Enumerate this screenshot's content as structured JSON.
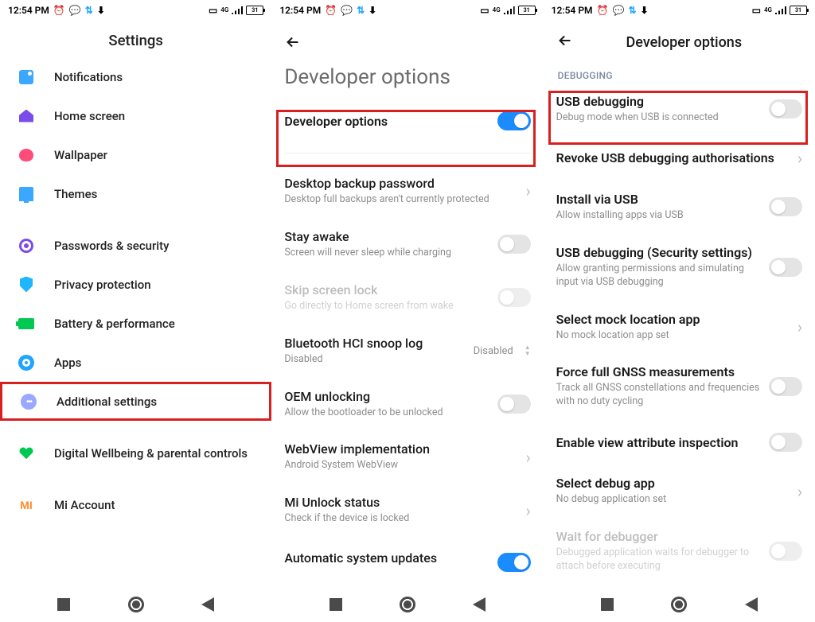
{
  "status": {
    "time": "12:54 PM",
    "battery_text": "31"
  },
  "phone1": {
    "title": "Settings",
    "items": [
      {
        "label": "Notifications"
      },
      {
        "label": "Home screen"
      },
      {
        "label": "Wallpaper"
      },
      {
        "label": "Themes"
      },
      {
        "label": "Passwords & security"
      },
      {
        "label": "Privacy protection"
      },
      {
        "label": "Battery & performance"
      },
      {
        "label": "Apps"
      },
      {
        "label": "Additional settings"
      },
      {
        "label": "Digital Wellbeing & parental controls"
      },
      {
        "label": "Mi Account"
      }
    ]
  },
  "phone2": {
    "heading": "Developer options",
    "master": {
      "title": "Developer options",
      "on": true
    },
    "rows": [
      {
        "title": "Desktop backup password",
        "sub": "Desktop full backups aren't currently protected",
        "type": "chevron"
      },
      {
        "title": "Stay awake",
        "sub": "Screen will never sleep while charging",
        "type": "toggle",
        "on": false
      },
      {
        "title": "Skip screen lock",
        "sub": "Go directly to Home screen from wake",
        "type": "toggle",
        "on": false,
        "disabled": true
      },
      {
        "title": "Bluetooth HCI snoop log",
        "sub": "Disabled",
        "type": "picker",
        "value": "Disabled"
      },
      {
        "title": "OEM unlocking",
        "sub": "Allow the bootloader to be unlocked",
        "type": "toggle",
        "on": false
      },
      {
        "title": "WebView implementation",
        "sub": "Android System WebView",
        "type": "chevron"
      },
      {
        "title": "Mi Unlock status",
        "sub": "Check if the device is locked",
        "type": "chevron"
      }
    ],
    "peek": {
      "title": "Automatic system updates"
    }
  },
  "phone3": {
    "heading": "Developer options",
    "section": "DEBUGGING",
    "rows": [
      {
        "title": "USB debugging",
        "sub": "Debug mode when USB is connected",
        "type": "toggle",
        "on": false
      },
      {
        "title": "Revoke USB debugging authorisations",
        "type": "chevron"
      },
      {
        "title": "Install via USB",
        "sub": "Allow installing apps via USB",
        "type": "toggle",
        "on": false
      },
      {
        "title": "USB debugging (Security settings)",
        "sub": "Allow granting permissions and simulating input via USB debugging",
        "type": "toggle",
        "on": false
      },
      {
        "title": "Select mock location app",
        "sub": "No mock location app set",
        "type": "chevron"
      },
      {
        "title": "Force full GNSS measurements",
        "sub": "Track all GNSS constellations and frequencies with no duty cycling",
        "type": "toggle",
        "on": false
      },
      {
        "title": "Enable view attribute inspection",
        "type": "toggle",
        "on": false
      },
      {
        "title": "Select debug app",
        "sub": "No debug application set",
        "type": "chevron"
      },
      {
        "title": "Wait for debugger",
        "sub": "Debugged application waits for debugger to attach before executing",
        "type": "toggle",
        "on": false,
        "disabled": true
      }
    ]
  }
}
